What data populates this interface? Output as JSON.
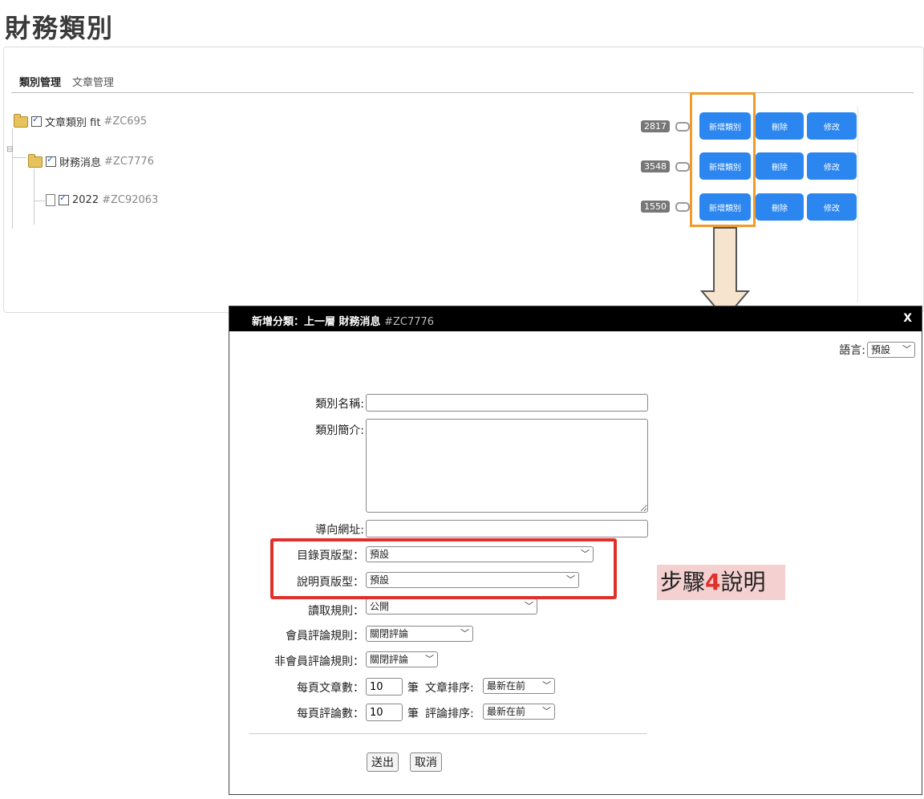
{
  "page": {
    "title": "財務類別"
  },
  "tabs": [
    {
      "label": "類別管理"
    },
    {
      "label": "文章管理"
    }
  ],
  "tree": {
    "nodes": [
      {
        "label": "文章類別 fit",
        "code": "#ZC695",
        "count": "2817"
      },
      {
        "label": "財務消息",
        "code": "#ZC7776",
        "count": "3548"
      },
      {
        "label": "2022",
        "code": "#ZC92063",
        "count": "1550"
      }
    ]
  },
  "actions": {
    "add_label": "新增類別",
    "delete_label": "刪除",
    "edit_label": "修改"
  },
  "modal": {
    "title": "新增分類：上一層 財務消息",
    "title_code": "#ZC7776",
    "close_label": "X",
    "language": {
      "label": "語言:",
      "value": "預設"
    },
    "fields": {
      "category_name_label": "類別名稱:",
      "category_intro_label": "類別簡介:",
      "redirect_url_label": "導向網址:",
      "list_template_label": "目錄頁版型：",
      "list_template_value": "預設",
      "desc_template_label": "說明頁版型：",
      "desc_template_value": "預設",
      "read_rule_label": "讀取規則：",
      "read_rule_value": "公開",
      "member_comment_label": "會員評論規則：",
      "member_comment_value": "關閉評論",
      "guest_comment_label": "非會員評論規則：",
      "guest_comment_value": "關閉評論",
      "articles_per_page_label": "每頁文章數：",
      "articles_per_page_value": "10",
      "article_unit": "筆",
      "article_sort_label": "文章排序:",
      "article_sort_value": "最新在前",
      "comments_per_page_label": "每頁評論數：",
      "comments_per_page_value": "10",
      "comment_unit": "筆",
      "comment_sort_label": "評論排序:",
      "comment_sort_value": "最新在前"
    },
    "buttons": {
      "submit": "送出",
      "cancel": "取消"
    }
  },
  "annotation": {
    "step_prefix": "步驟",
    "step_number": "4",
    "step_suffix": "說明"
  },
  "colors": {
    "button_blue": "#2b86f0",
    "highlight_orange": "#f09b2a",
    "highlight_red": "#e0302a"
  }
}
